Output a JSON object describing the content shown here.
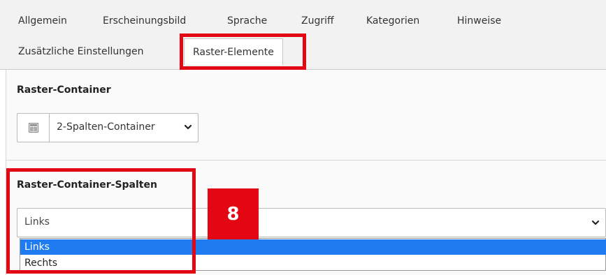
{
  "tabs": [
    {
      "label": "Allgemein"
    },
    {
      "label": "Erscheinungsbild"
    },
    {
      "label": "Sprache"
    },
    {
      "label": "Zugriff"
    },
    {
      "label": "Kategorien"
    },
    {
      "label": "Hinweise"
    },
    {
      "label": "Zusätzliche Einstellungen"
    },
    {
      "label": "Raster-Elemente",
      "active": true
    }
  ],
  "raster_container": {
    "title": "Raster-Container",
    "icon": "grid-container-icon",
    "selected": "2-Spalten-Container"
  },
  "raster_container_spalten": {
    "title": "Raster-Container-Spalten",
    "selected": "Links",
    "options": [
      "Links",
      "Rechts"
    ]
  },
  "annotation": {
    "step_number": "8",
    "highlight_color": "#e30613"
  },
  "colors": {
    "selection": "#1e7bf0"
  }
}
